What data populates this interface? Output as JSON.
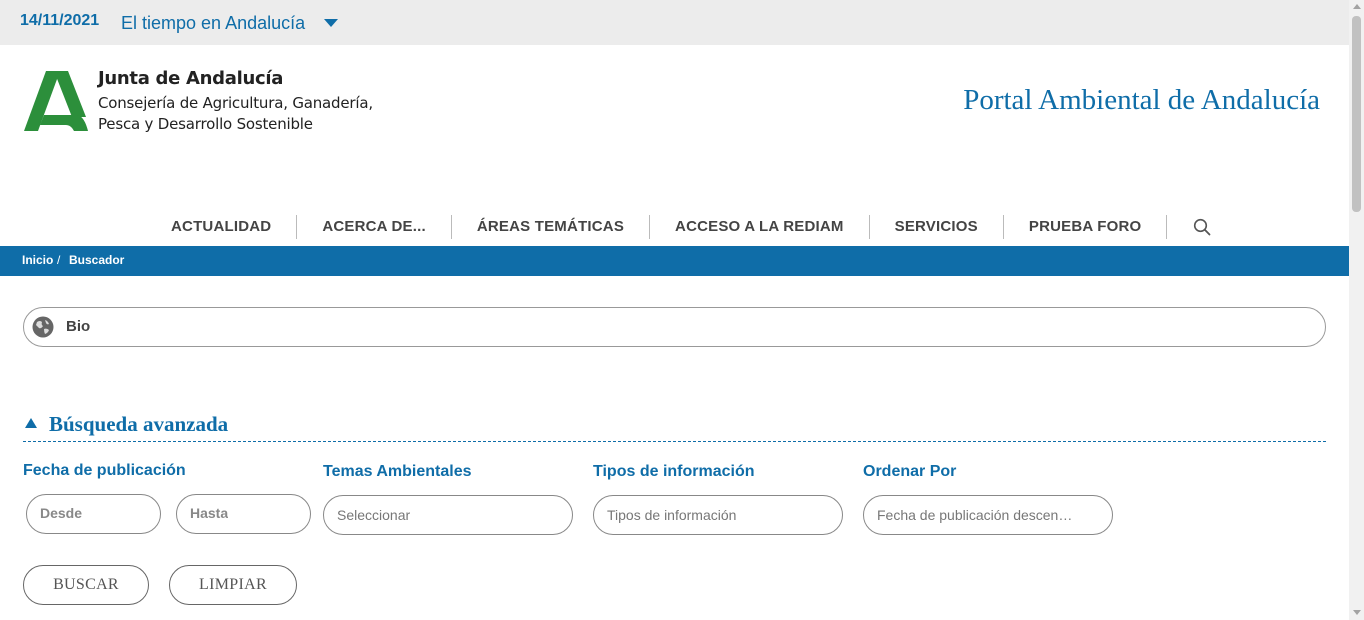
{
  "topbar": {
    "date": "14/11/2021",
    "weather_label": "El tiempo en Andalucía"
  },
  "header": {
    "org_title": "Junta de Andalucía",
    "org_sub_line1": "Consejería de Agricultura, Ganadería,",
    "org_sub_line2": "Pesca y Desarrollo Sostenible",
    "portal_title": "Portal Ambiental de Andalucía"
  },
  "nav": {
    "items": [
      "ACTUALIDAD",
      "ACERCA DE...",
      "ÁREAS TEMÁTICAS",
      "ACCESO A LA REDIAM",
      "SERVICIOS",
      "PRUEBA FORO"
    ],
    "search_icon": "search-icon"
  },
  "breadcrumb": {
    "home": "Inicio",
    "separator": "/",
    "current": "Buscador"
  },
  "search": {
    "query": "Bio",
    "icon": "globe-icon"
  },
  "advanced": {
    "title": "Búsqueda avanzada",
    "date_label": "Fecha de publicación",
    "from_placeholder": "Desde",
    "to_placeholder": "Hasta",
    "themes_label": "Temas Ambientales",
    "themes_placeholder": "Seleccionar",
    "types_label": "Tipos de información",
    "types_placeholder": "Tipos de información",
    "order_label": "Ordenar Por",
    "order_value": "Fecha de publicación descen…",
    "search_button": "BUSCAR",
    "clear_button": "LIMPIAR"
  },
  "colors": {
    "brand_blue": "#0f6da8",
    "brand_green": "#2c8f3b"
  }
}
